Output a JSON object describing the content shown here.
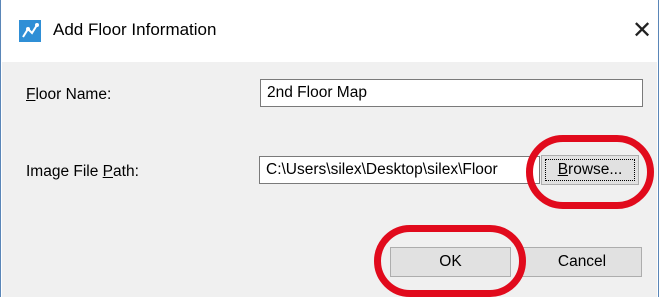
{
  "window": {
    "title": "Add Floor Information",
    "close_glyph": "✕"
  },
  "form": {
    "floor_name_label_prefix": "",
    "floor_name_label_mnemonic": "F",
    "floor_name_label_rest": "loor Name:",
    "floor_name_value": "2nd Floor Map",
    "image_path_label_prefix": "Image File ",
    "image_path_label_mnemonic": "P",
    "image_path_label_rest": "ath:",
    "image_path_value": "C:\\Users\\silex\\Desktop\\silex\\Floor",
    "browse_label_mnemonic": "B",
    "browse_label_rest": "rowse..."
  },
  "buttons": {
    "ok_label": "OK",
    "cancel_label": "Cancel"
  },
  "colors": {
    "highlight": "#e10a1c",
    "accent": "#2f8fd6"
  },
  "icons": {
    "app": "app-icon",
    "close": "close-icon"
  }
}
